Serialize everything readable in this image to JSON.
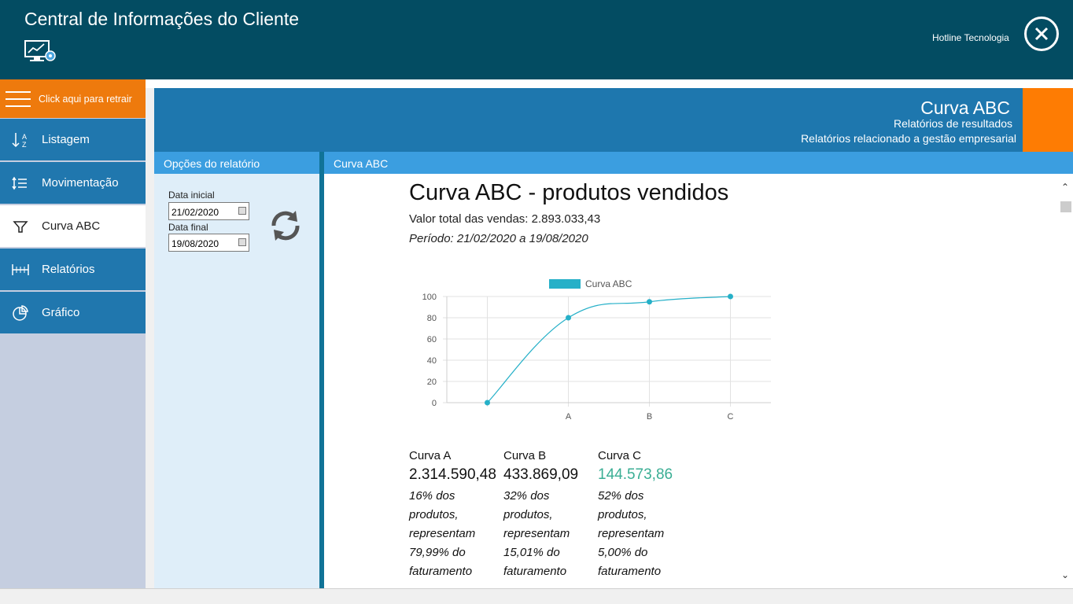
{
  "app": {
    "title": "Central de Informações do Cliente",
    "company": "Hotline Tecnologia"
  },
  "sidebar": {
    "retract_label": "Click aqui para retrair",
    "items": [
      {
        "label": "Listagem",
        "icon": "sort-az-icon"
      },
      {
        "label": "Movimentação",
        "icon": "movement-icon"
      },
      {
        "label": "Curva ABC",
        "icon": "funnel-icon",
        "active": true
      },
      {
        "label": "Relatórios",
        "icon": "ruler-icon"
      },
      {
        "label": "Gráfico",
        "icon": "pie-chart-icon"
      }
    ]
  },
  "header": {
    "title": "Curva ABC",
    "subtitle1": "Relatórios de resultados",
    "subtitle2": "Relatórios relacionado a gestão empresarial"
  },
  "options": {
    "title": "Opções do relatório",
    "start_label": "Data inicial",
    "start_value": "21/02/2020",
    "end_label": "Data final",
    "end_value": "19/08/2020"
  },
  "report": {
    "tab": "Curva ABC",
    "title": "Curva ABC - produtos vendidos",
    "total": "Valor total das vendas: 2.893.033,43",
    "period": "Período: 21/02/2020 a 19/08/2020",
    "curves": [
      {
        "label": "Curva A",
        "value": "2.314.590,48",
        "desc": [
          "16% dos",
          "produtos,",
          "representam",
          "79,99% do",
          "faturamento"
        ],
        "color": "#111111"
      },
      {
        "label": "Curva B",
        "value": "433.869,09",
        "desc": [
          "32% dos",
          "produtos,",
          "representam",
          "15,01% do",
          "faturamento"
        ],
        "color": "#111111"
      },
      {
        "label": "Curva C",
        "value": "144.573,86",
        "desc": [
          "52% dos",
          "produtos,",
          "representam",
          "5,00% do",
          "faturamento"
        ],
        "color": "#3aae94"
      }
    ]
  },
  "colors": {
    "topbar": "#034c62",
    "accent_orange": "#fe7c03",
    "nav_blue": "#2077ae",
    "series": "#26b0c8"
  },
  "chart_data": {
    "type": "line",
    "categories": [
      "",
      "A",
      "B",
      "C"
    ],
    "series": [
      {
        "name": "Curva ABC",
        "values": [
          0,
          80,
          95,
          100
        ]
      }
    ],
    "yticks": [
      0,
      20,
      40,
      60,
      80,
      100
    ],
    "ylim": [
      0,
      100
    ],
    "legend": "top",
    "grid": true
  }
}
